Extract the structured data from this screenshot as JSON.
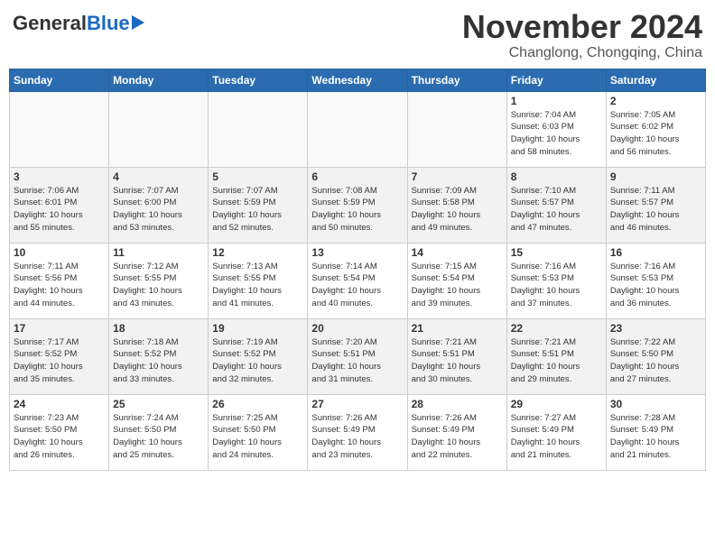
{
  "header": {
    "logo_general": "General",
    "logo_blue": "Blue",
    "month": "November 2024",
    "location": "Changlong, Chongqing, China"
  },
  "weekdays": [
    "Sunday",
    "Monday",
    "Tuesday",
    "Wednesday",
    "Thursday",
    "Friday",
    "Saturday"
  ],
  "weeks": [
    [
      {
        "day": "",
        "info": ""
      },
      {
        "day": "",
        "info": ""
      },
      {
        "day": "",
        "info": ""
      },
      {
        "day": "",
        "info": ""
      },
      {
        "day": "",
        "info": ""
      },
      {
        "day": "1",
        "info": "Sunrise: 7:04 AM\nSunset: 6:03 PM\nDaylight: 10 hours\nand 58 minutes."
      },
      {
        "day": "2",
        "info": "Sunrise: 7:05 AM\nSunset: 6:02 PM\nDaylight: 10 hours\nand 56 minutes."
      }
    ],
    [
      {
        "day": "3",
        "info": "Sunrise: 7:06 AM\nSunset: 6:01 PM\nDaylight: 10 hours\nand 55 minutes."
      },
      {
        "day": "4",
        "info": "Sunrise: 7:07 AM\nSunset: 6:00 PM\nDaylight: 10 hours\nand 53 minutes."
      },
      {
        "day": "5",
        "info": "Sunrise: 7:07 AM\nSunset: 5:59 PM\nDaylight: 10 hours\nand 52 minutes."
      },
      {
        "day": "6",
        "info": "Sunrise: 7:08 AM\nSunset: 5:59 PM\nDaylight: 10 hours\nand 50 minutes."
      },
      {
        "day": "7",
        "info": "Sunrise: 7:09 AM\nSunset: 5:58 PM\nDaylight: 10 hours\nand 49 minutes."
      },
      {
        "day": "8",
        "info": "Sunrise: 7:10 AM\nSunset: 5:57 PM\nDaylight: 10 hours\nand 47 minutes."
      },
      {
        "day": "9",
        "info": "Sunrise: 7:11 AM\nSunset: 5:57 PM\nDaylight: 10 hours\nand 46 minutes."
      }
    ],
    [
      {
        "day": "10",
        "info": "Sunrise: 7:11 AM\nSunset: 5:56 PM\nDaylight: 10 hours\nand 44 minutes."
      },
      {
        "day": "11",
        "info": "Sunrise: 7:12 AM\nSunset: 5:55 PM\nDaylight: 10 hours\nand 43 minutes."
      },
      {
        "day": "12",
        "info": "Sunrise: 7:13 AM\nSunset: 5:55 PM\nDaylight: 10 hours\nand 41 minutes."
      },
      {
        "day": "13",
        "info": "Sunrise: 7:14 AM\nSunset: 5:54 PM\nDaylight: 10 hours\nand 40 minutes."
      },
      {
        "day": "14",
        "info": "Sunrise: 7:15 AM\nSunset: 5:54 PM\nDaylight: 10 hours\nand 39 minutes."
      },
      {
        "day": "15",
        "info": "Sunrise: 7:16 AM\nSunset: 5:53 PM\nDaylight: 10 hours\nand 37 minutes."
      },
      {
        "day": "16",
        "info": "Sunrise: 7:16 AM\nSunset: 5:53 PM\nDaylight: 10 hours\nand 36 minutes."
      }
    ],
    [
      {
        "day": "17",
        "info": "Sunrise: 7:17 AM\nSunset: 5:52 PM\nDaylight: 10 hours\nand 35 minutes."
      },
      {
        "day": "18",
        "info": "Sunrise: 7:18 AM\nSunset: 5:52 PM\nDaylight: 10 hours\nand 33 minutes."
      },
      {
        "day": "19",
        "info": "Sunrise: 7:19 AM\nSunset: 5:52 PM\nDaylight: 10 hours\nand 32 minutes."
      },
      {
        "day": "20",
        "info": "Sunrise: 7:20 AM\nSunset: 5:51 PM\nDaylight: 10 hours\nand 31 minutes."
      },
      {
        "day": "21",
        "info": "Sunrise: 7:21 AM\nSunset: 5:51 PM\nDaylight: 10 hours\nand 30 minutes."
      },
      {
        "day": "22",
        "info": "Sunrise: 7:21 AM\nSunset: 5:51 PM\nDaylight: 10 hours\nand 29 minutes."
      },
      {
        "day": "23",
        "info": "Sunrise: 7:22 AM\nSunset: 5:50 PM\nDaylight: 10 hours\nand 27 minutes."
      }
    ],
    [
      {
        "day": "24",
        "info": "Sunrise: 7:23 AM\nSunset: 5:50 PM\nDaylight: 10 hours\nand 26 minutes."
      },
      {
        "day": "25",
        "info": "Sunrise: 7:24 AM\nSunset: 5:50 PM\nDaylight: 10 hours\nand 25 minutes."
      },
      {
        "day": "26",
        "info": "Sunrise: 7:25 AM\nSunset: 5:50 PM\nDaylight: 10 hours\nand 24 minutes."
      },
      {
        "day": "27",
        "info": "Sunrise: 7:26 AM\nSunset: 5:49 PM\nDaylight: 10 hours\nand 23 minutes."
      },
      {
        "day": "28",
        "info": "Sunrise: 7:26 AM\nSunset: 5:49 PM\nDaylight: 10 hours\nand 22 minutes."
      },
      {
        "day": "29",
        "info": "Sunrise: 7:27 AM\nSunset: 5:49 PM\nDaylight: 10 hours\nand 21 minutes."
      },
      {
        "day": "30",
        "info": "Sunrise: 7:28 AM\nSunset: 5:49 PM\nDaylight: 10 hours\nand 21 minutes."
      }
    ]
  ]
}
